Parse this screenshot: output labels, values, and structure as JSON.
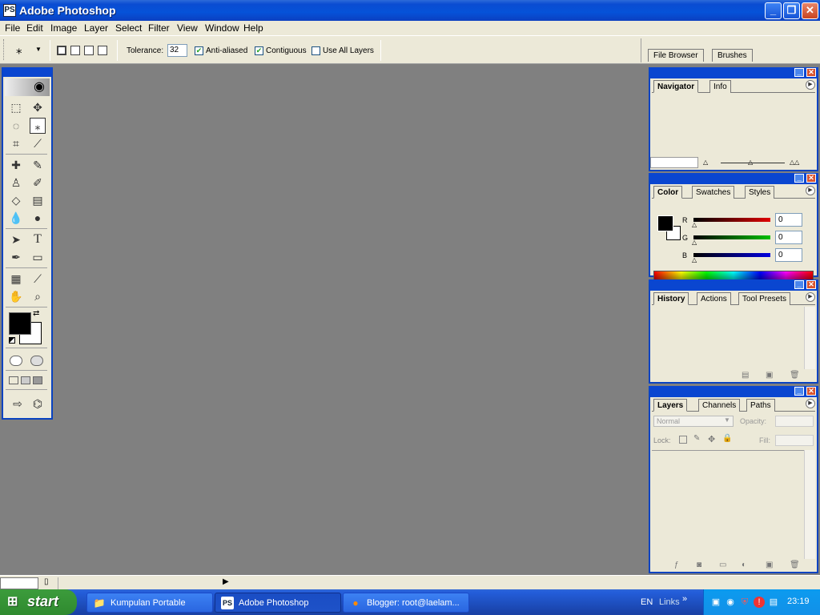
{
  "window": {
    "title": "Adobe Photoshop",
    "app_icon": "photoshop-icon"
  },
  "menu": [
    "File",
    "Edit",
    "Image",
    "Layer",
    "Select",
    "Filter",
    "View",
    "Window",
    "Help"
  ],
  "options": {
    "tolerance_label": "Tolerance:",
    "tolerance_value": "32",
    "anti_aliased_label": "Anti-aliased",
    "anti_aliased_checked": true,
    "contiguous_label": "Contiguous",
    "contiguous_checked": true,
    "use_all_layers_label": "Use All Layers",
    "use_all_layers_checked": false,
    "well_tabs": [
      "File Browser",
      "Brushes"
    ]
  },
  "palettes": {
    "navigator": {
      "tabs": [
        "Navigator",
        "Info"
      ]
    },
    "color": {
      "tabs": [
        "Color",
        "Swatches",
        "Styles"
      ],
      "channels": [
        {
          "label": "R",
          "value": "0",
          "color": "#cc0000"
        },
        {
          "label": "G",
          "value": "0",
          "color": "#00aa00"
        },
        {
          "label": "B",
          "value": "0",
          "color": "#0000cc"
        }
      ]
    },
    "history": {
      "tabs": [
        "History",
        "Actions",
        "Tool Presets"
      ]
    },
    "layers": {
      "tabs": [
        "Layers",
        "Channels",
        "Paths"
      ],
      "blend_mode": "Normal",
      "opacity_label": "Opacity:",
      "lock_label": "Lock:",
      "fill_label": "Fill:"
    }
  },
  "taskbar": {
    "start_label": "start",
    "tasks": [
      {
        "label": "Kumpulan Portable",
        "icon": "folder-icon"
      },
      {
        "label": "Adobe Photoshop",
        "icon": "photoshop-icon",
        "active": true
      },
      {
        "label": "Blogger: root@laelam...",
        "icon": "firefox-icon"
      }
    ],
    "language": "EN",
    "links_label": "Links",
    "clock": "23:19"
  },
  "colors": {
    "title_blue": "#0a4cd2",
    "canvas_gray": "#808080",
    "panel_bg": "#ece9d8",
    "start_green": "#3c9c3c"
  }
}
